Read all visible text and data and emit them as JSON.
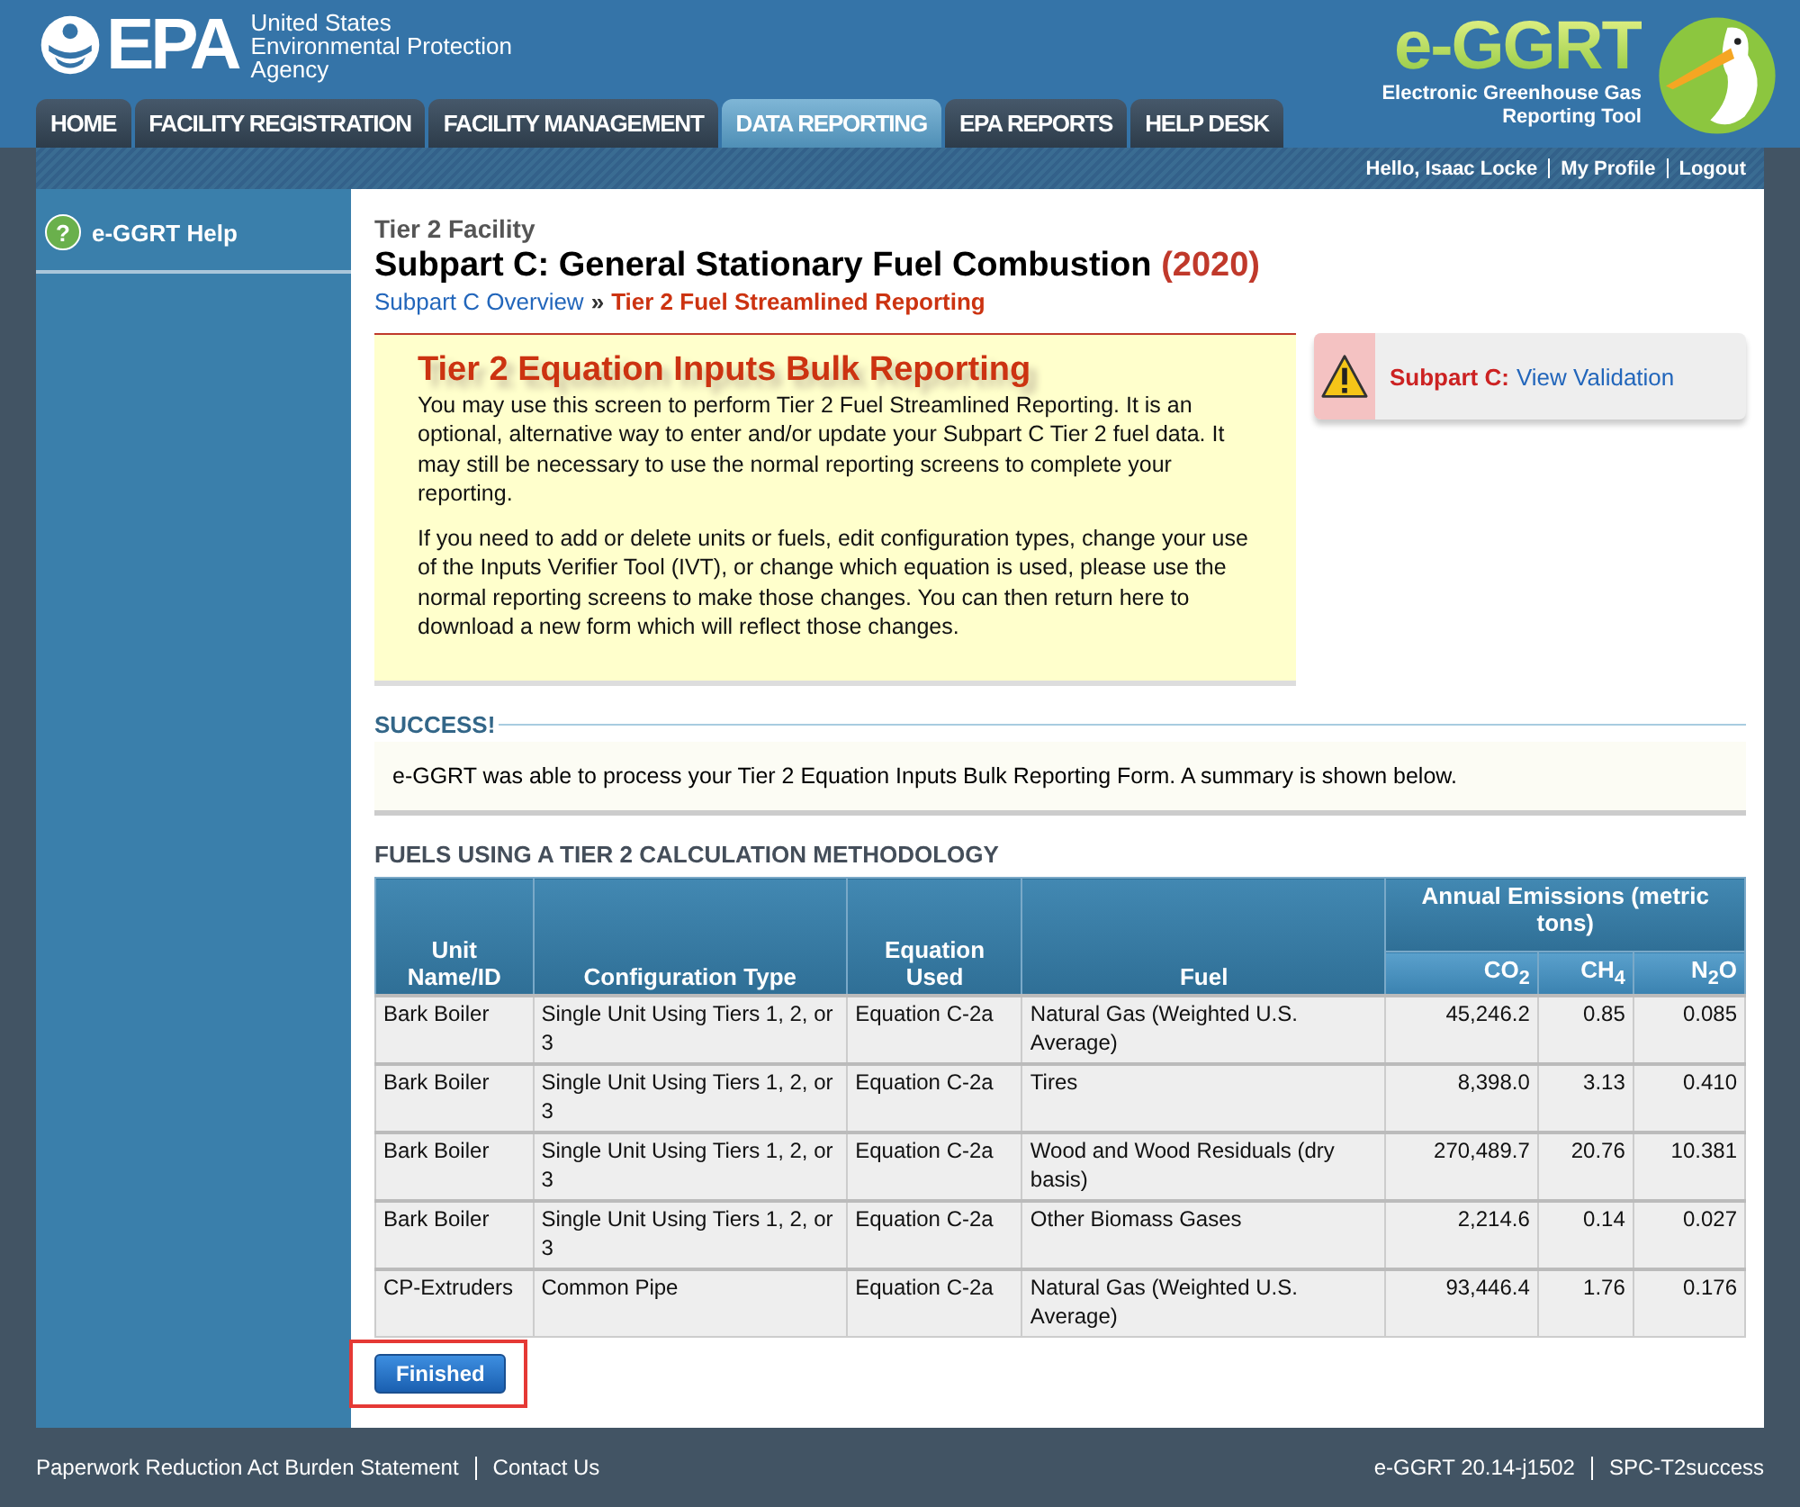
{
  "header": {
    "agency_logo": "EPA",
    "agency_name": [
      "United States",
      "Environmental Protection",
      "Agency"
    ],
    "app_logo": "e-GGRT",
    "app_name": [
      "Electronic Greenhouse Gas",
      "Reporting Tool"
    ]
  },
  "tabs": [
    {
      "label": "HOME",
      "selected": false
    },
    {
      "label": "FACILITY REGISTRATION",
      "selected": false
    },
    {
      "label": "FACILITY MANAGEMENT",
      "selected": false
    },
    {
      "label": "DATA REPORTING",
      "selected": true
    },
    {
      "label": "EPA REPORTS",
      "selected": false
    },
    {
      "label": "HELP DESK",
      "selected": false
    }
  ],
  "user_bar": {
    "greeting": "Hello, Isaac Locke",
    "links": [
      "My Profile",
      "Logout"
    ]
  },
  "sidebar": {
    "items": [
      {
        "icon": "?",
        "label": "e-GGRT Help"
      }
    ]
  },
  "page": {
    "facility": "Tier 2 Facility",
    "title": "Subpart C: General Stationary Fuel Combustion",
    "year": "(2020)",
    "breadcrumb": [
      {
        "label": "Subpart C Overview",
        "current": false
      },
      {
        "label": "Tier 2 Fuel Streamlined Reporting",
        "current": true
      }
    ],
    "breadcrumb_separator": "»"
  },
  "info_box": {
    "title": "Tier 2 Equation Inputs Bulk Reporting",
    "paragraphs": [
      "You may use this screen to perform Tier 2 Fuel Streamlined Reporting. It is an optional, alternative way to enter and/or update your Subpart C Tier 2 fuel data. It may still be necessary to use the normal reporting screens to complete your reporting.",
      "If you need to add or delete units or fuels, edit configuration types, change your use of the Inputs Verifier Tool (IVT), or change which equation is used, please use the normal reporting screens to make those changes. You can then return here to download a new form which will reflect those changes."
    ]
  },
  "validation": {
    "label": "Subpart C:",
    "link": "View Validation"
  },
  "success": {
    "title": "SUCCESS!",
    "message": "e-GGRT was able to process your Tier 2 Equation Inputs Bulk Reporting Form. A summary is shown below."
  },
  "table": {
    "title": "FUELS USING A TIER 2 CALCULATION METHODOLOGY",
    "columns": [
      "Unit Name/ID",
      "Configuration Type",
      "Equation Used",
      "Fuel"
    ],
    "group_header": "Annual Emissions (metric tons)",
    "sub_columns": [
      "CO$_{2}$",
      "CH$_{4}$",
      "N$_{2}$O"
    ],
    "rows": [
      [
        "Bark Boiler",
        "Single Unit Using Tiers 1, 2, or 3",
        "Equation C-2a",
        "Natural Gas (Weighted U.S. Average)",
        "45,246.2",
        "0.85",
        "0.085"
      ],
      [
        "Bark Boiler",
        "Single Unit Using Tiers 1, 2, or 3",
        "Equation C-2a",
        "Tires",
        "8,398.0",
        "3.13",
        "0.410"
      ],
      [
        "Bark Boiler",
        "Single Unit Using Tiers 1, 2, or 3",
        "Equation C-2a",
        "Wood and Wood Residuals (dry basis)",
        "270,489.7",
        "20.76",
        "10.381"
      ],
      [
        "Bark Boiler",
        "Single Unit Using Tiers 1, 2, or 3",
        "Equation C-2a",
        "Other Biomass Gases",
        "2,214.6",
        "0.14",
        "0.027"
      ],
      [
        "CP-Extruders",
        "Common Pipe",
        "Equation C-2a",
        "Natural Gas (Weighted U.S. Average)",
        "93,446.4",
        "1.76",
        "0.176"
      ]
    ]
  },
  "finished_button": {
    "label": "Finished",
    "highlighted": true
  },
  "footer": {
    "left": [
      "Paperwork Reduction Act Burden Statement",
      "Contact Us"
    ],
    "right": [
      "e-GGRT 20.14-j1502",
      "SPC-T2success"
    ]
  }
}
